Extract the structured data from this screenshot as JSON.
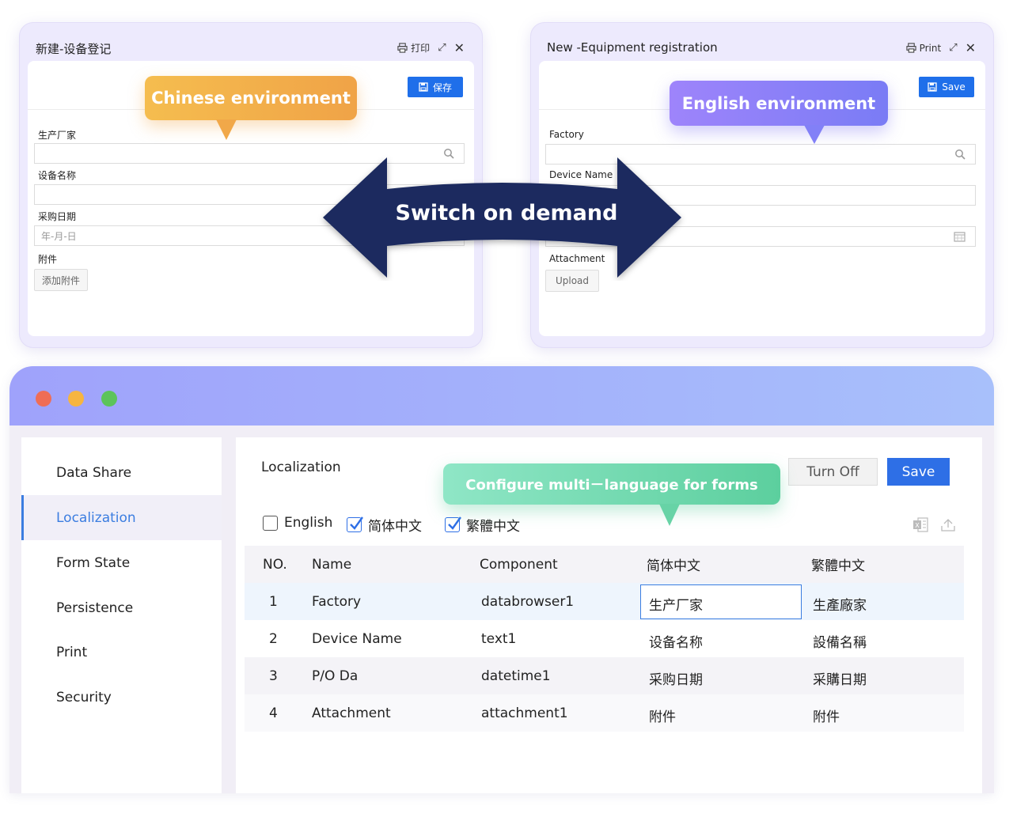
{
  "chinese_window": {
    "title": "新建-设备登记",
    "print_label": "打印",
    "save_label": "保存",
    "fields": [
      {
        "label": "生产厂家",
        "placeholder": ""
      },
      {
        "label": "设备名称",
        "placeholder": ""
      },
      {
        "label": "采购日期",
        "placeholder": "年-月-日"
      },
      {
        "label": "附件"
      }
    ],
    "upload_label": "添加附件"
  },
  "english_window": {
    "title": "New -Equipment registration",
    "print_label": "Print",
    "save_label": "Save",
    "fields": [
      {
        "label": "Factory"
      },
      {
        "label": "Device Name"
      },
      {
        "label": ""
      },
      {
        "label": "Attachment"
      }
    ],
    "upload_label": "Upload"
  },
  "callouts": {
    "chinese": "Chinese environment",
    "english": "English environment",
    "switch": "Switch on demand",
    "configure": "Configure multi－language for forms"
  },
  "colors": {
    "brand_blue": "#2e6fe6",
    "callout_orange": "#f2ad4b",
    "callout_purple": "#8b80f8",
    "callout_green": "#72d8b0",
    "arrow_navy": "#1b2b5e",
    "dot_red": "#ef6d56",
    "dot_yellow": "#f6b540",
    "dot_green": "#5cc45a"
  },
  "app": {
    "sidebar": {
      "items": [
        {
          "label": "Data Share",
          "active": false
        },
        {
          "label": "Localization",
          "active": true
        },
        {
          "label": "Form State",
          "active": false
        },
        {
          "label": "Persistence",
          "active": false
        },
        {
          "label": "Print",
          "active": false
        },
        {
          "label": "Security",
          "active": false
        }
      ]
    },
    "main": {
      "title": "Localization",
      "turn_off_label": "Turn Off",
      "save_label": "Save",
      "languages": [
        {
          "label": "English",
          "checked": false
        },
        {
          "label": "简体中文",
          "checked": true
        },
        {
          "label": "繁體中文",
          "checked": true
        }
      ],
      "columns": [
        "NO.",
        "Name",
        "Component",
        "简体中文",
        "繁體中文"
      ],
      "rows": [
        [
          "1",
          "Factory",
          "databrowser1",
          "生产厂家",
          "生產廠家"
        ],
        [
          "2",
          "Device Name",
          "text1",
          "设备名称",
          "設備名稱"
        ],
        [
          "3",
          "P/O Da",
          "datetime1",
          "采购日期",
          "采購日期"
        ],
        [
          "4",
          "Attachment",
          "attachment1",
          "附件",
          "附件"
        ]
      ]
    }
  }
}
